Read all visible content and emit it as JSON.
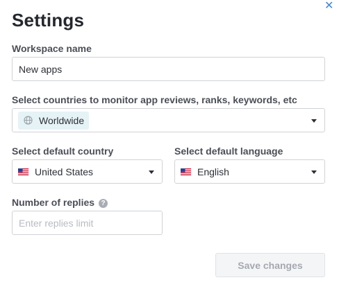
{
  "dialog": {
    "title": "Settings",
    "close_icon": "close-icon",
    "accent_color": "#3f86e0"
  },
  "workspace_name": {
    "label": "Workspace name",
    "value": "New apps"
  },
  "countries_monitor": {
    "label": "Select countries to monitor app reviews, ranks, keywords, etc",
    "selected": [
      "Worldwide"
    ],
    "icon": "globe-icon"
  },
  "default_country": {
    "label": "Select default country",
    "value": "United States",
    "icon": "us-flag-icon"
  },
  "default_language": {
    "label": "Select default language",
    "value": "English",
    "icon": "us-flag-icon"
  },
  "replies": {
    "label": "Number of replies",
    "help_icon": "question-icon",
    "help_symbol": "?",
    "placeholder": "Enter replies limit"
  },
  "actions": {
    "save_label": "Save changes",
    "save_enabled": false
  }
}
